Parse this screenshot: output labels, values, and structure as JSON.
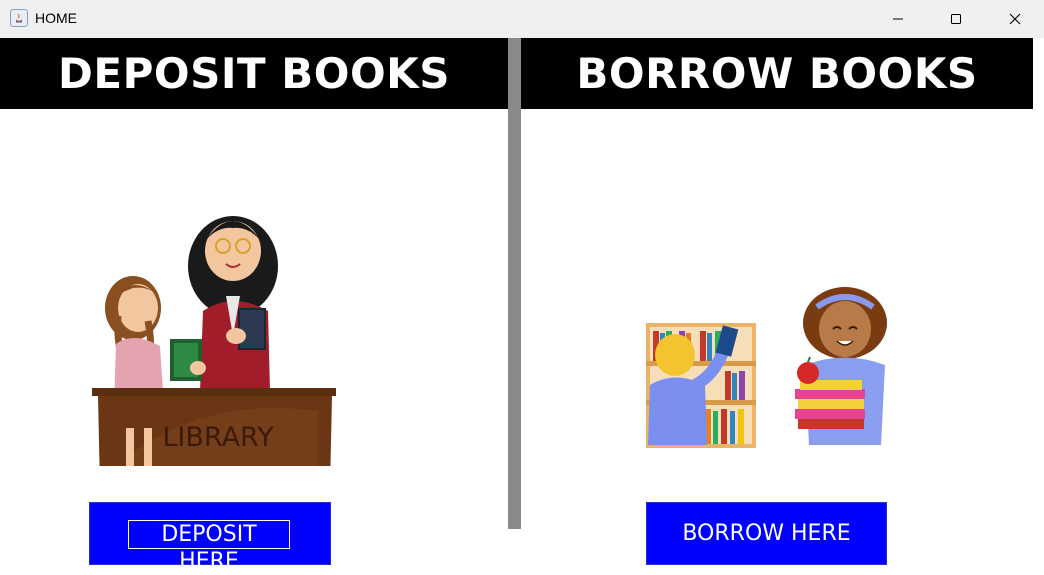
{
  "window": {
    "title": "HOME"
  },
  "deposit": {
    "heading": "DEPOSIT BOOKS",
    "desk_label": "LIBRARY",
    "button_label": "DEPOSIT HERE"
  },
  "borrow": {
    "heading": "BORROW BOOKS",
    "button_label": "BORROW HERE"
  },
  "colors": {
    "header_bg": "#000000",
    "header_text": "#ffffff",
    "button_bg": "#0000ff",
    "divider": "#8a8a8a"
  }
}
